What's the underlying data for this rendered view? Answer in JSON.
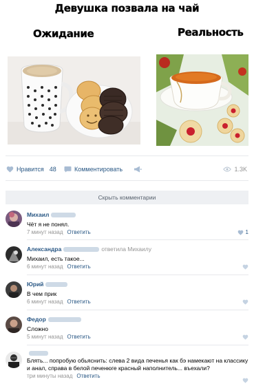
{
  "meme": {
    "title": "Девушка позвала на чай",
    "left_label": "Ожидание",
    "right_label": "Реальность"
  },
  "post_actions": {
    "like_label": "Нравится",
    "like_count": "48",
    "comment_label": "Комментировать",
    "views": "1.3K"
  },
  "hide_comments_label": "Скрыть комментарии",
  "comments": [
    {
      "name": "Михаил",
      "text": "Чёт я не понял.",
      "time": "7 минут назад",
      "reply": "Ответить",
      "likes": "1"
    },
    {
      "name": "Александра",
      "reply_to": "ответила Михаилу",
      "text": "Михаил, есть такое...",
      "time": "6 минут назад",
      "reply": "Ответить"
    },
    {
      "name": "Юрий",
      "text": "В чем прик",
      "time": "6 минут назад",
      "reply": "Ответить"
    },
    {
      "name": "Федор",
      "text": "Сложно",
      "time": "5 минут назад",
      "reply": "Ответить"
    },
    {
      "name": "",
      "text": "Блять... попробую обьяснить: слева 2 вида печенья как бэ намекают на классику и анал, справа в белой печенюге красный наполнитель... въехали?",
      "time": "три минуты назад",
      "reply": "Ответить"
    }
  ],
  "colors": {
    "link": "#2a5885",
    "muted": "#939393",
    "hide_bar": "#eef0f3"
  }
}
